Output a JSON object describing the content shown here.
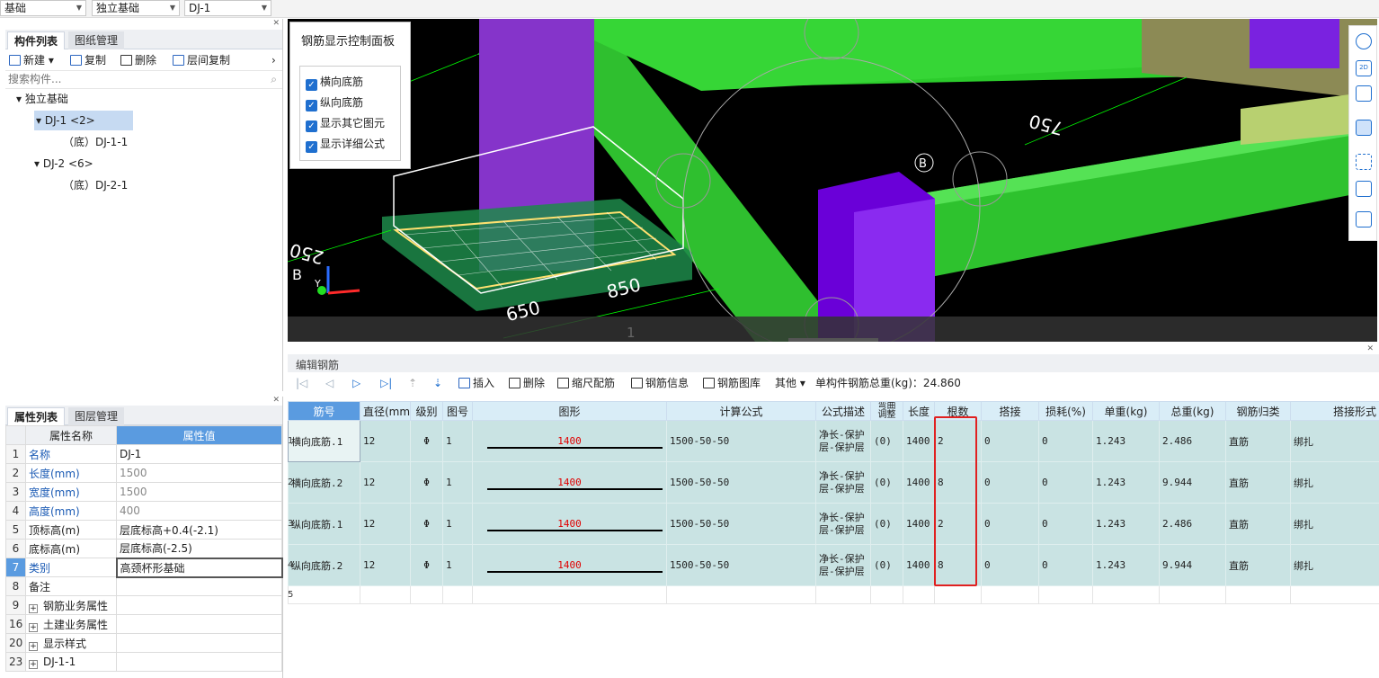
{
  "top": {
    "dd1": "基础",
    "dd2": "独立基础",
    "dd3": "DJ-1"
  },
  "left": {
    "tabs": [
      "构件列表",
      "图纸管理"
    ],
    "toolbar": {
      "new": "新建",
      "copy": "复制",
      "delete": "删除",
      "floor_copy": "层间复制"
    },
    "search_placeholder": "搜索构件...",
    "tree": {
      "root": "独立基础",
      "n1": "DJ-1 <2>",
      "n1c": "（底）DJ-1-1",
      "n2": "DJ-2 <6>",
      "n2c": "（底）DJ-2-1"
    }
  },
  "props": {
    "tabs": [
      "属性列表",
      "图层管理"
    ],
    "header": [
      "属性名称",
      "属性值"
    ],
    "rows": [
      {
        "n": "1",
        "k": "名称",
        "v": "DJ-1"
      },
      {
        "n": "2",
        "k": "长度(mm)",
        "v": "1500"
      },
      {
        "n": "3",
        "k": "宽度(mm)",
        "v": "1500"
      },
      {
        "n": "4",
        "k": "高度(mm)",
        "v": "400"
      },
      {
        "n": "5",
        "k": "顶标高(m)",
        "v": "层底标高+0.4(-2.1)"
      },
      {
        "n": "6",
        "k": "底标高(m)",
        "v": "层底标高(-2.5)"
      },
      {
        "n": "7",
        "k": "类别",
        "v": "高颈杯形基础"
      },
      {
        "n": "8",
        "k": "备注",
        "v": ""
      },
      {
        "n": "9",
        "k": "钢筋业务属性",
        "v": ""
      },
      {
        "n": "16",
        "k": "土建业务属性",
        "v": ""
      },
      {
        "n": "20",
        "k": "显示样式",
        "v": ""
      },
      {
        "n": "23",
        "k": "DJ-1-1",
        "v": ""
      }
    ]
  },
  "view": {
    "panel_title": "钢筋显示控制面板",
    "checks": [
      "横向底筋",
      "纵向底筋",
      "显示其它图元",
      "显示详细公式"
    ],
    "dims": [
      "650",
      "850",
      "750",
      "250"
    ],
    "labels": {
      "b1": "B",
      "b2": "B",
      "axis1": "1",
      "axis_y": "Y"
    },
    "tools": [
      "3D",
      "2D",
      "",
      "",
      "",
      "",
      "",
      ""
    ]
  },
  "edit": {
    "title": "编辑钢筋",
    "toolbar": {
      "insert": "插入",
      "delete": "删除",
      "scale": "缩尺配筋",
      "info": "钢筋信息",
      "lib": "钢筋图库",
      "other": "其他",
      "total": "单构件钢筋总重(kg)：24.860"
    },
    "headers": [
      "筋号",
      "直径(mm)",
      "级别",
      "图号",
      "图形",
      "计算公式",
      "公式描述",
      "弯曲调整",
      "长度",
      "根数",
      "搭接",
      "损耗(%)",
      "单重(kg)",
      "总重(kg)",
      "钢筋归类",
      "搭接形式"
    ],
    "rows": [
      {
        "n": "1",
        "name": "横向底筋.1",
        "d": "12",
        "lv": "Φ",
        "fig": "1",
        "shape": "1400",
        "calc": "1500-50-50",
        "desc": "净长-保护层-保护层",
        "bend": "(0)",
        "len": "1400",
        "cnt": "2",
        "lap": "0",
        "loss": "0",
        "uw": "1.243",
        "tw": "2.486",
        "cls": "直筋",
        "form": "绑扎"
      },
      {
        "n": "2",
        "name": "横向底筋.2",
        "d": "12",
        "lv": "Φ",
        "fig": "1",
        "shape": "1400",
        "calc": "1500-50-50",
        "desc": "净长-保护层-保护层",
        "bend": "(0)",
        "len": "1400",
        "cnt": "8",
        "lap": "0",
        "loss": "0",
        "uw": "1.243",
        "tw": "9.944",
        "cls": "直筋",
        "form": "绑扎"
      },
      {
        "n": "3",
        "name": "纵向底筋.1",
        "d": "12",
        "lv": "Φ",
        "fig": "1",
        "shape": "1400",
        "calc": "1500-50-50",
        "desc": "净长-保护层-保护层",
        "bend": "(0)",
        "len": "1400",
        "cnt": "2",
        "lap": "0",
        "loss": "0",
        "uw": "1.243",
        "tw": "2.486",
        "cls": "直筋",
        "form": "绑扎"
      },
      {
        "n": "4",
        "name": "纵向底筋.2",
        "d": "12",
        "lv": "Φ",
        "fig": "1",
        "shape": "1400",
        "calc": "1500-50-50",
        "desc": "净长-保护层-保护层",
        "bend": "(0)",
        "len": "1400",
        "cnt": "8",
        "lap": "0",
        "loss": "0",
        "uw": "1.243",
        "tw": "9.944",
        "cls": "直筋",
        "form": "绑扎"
      }
    ],
    "empty_row": "5"
  }
}
